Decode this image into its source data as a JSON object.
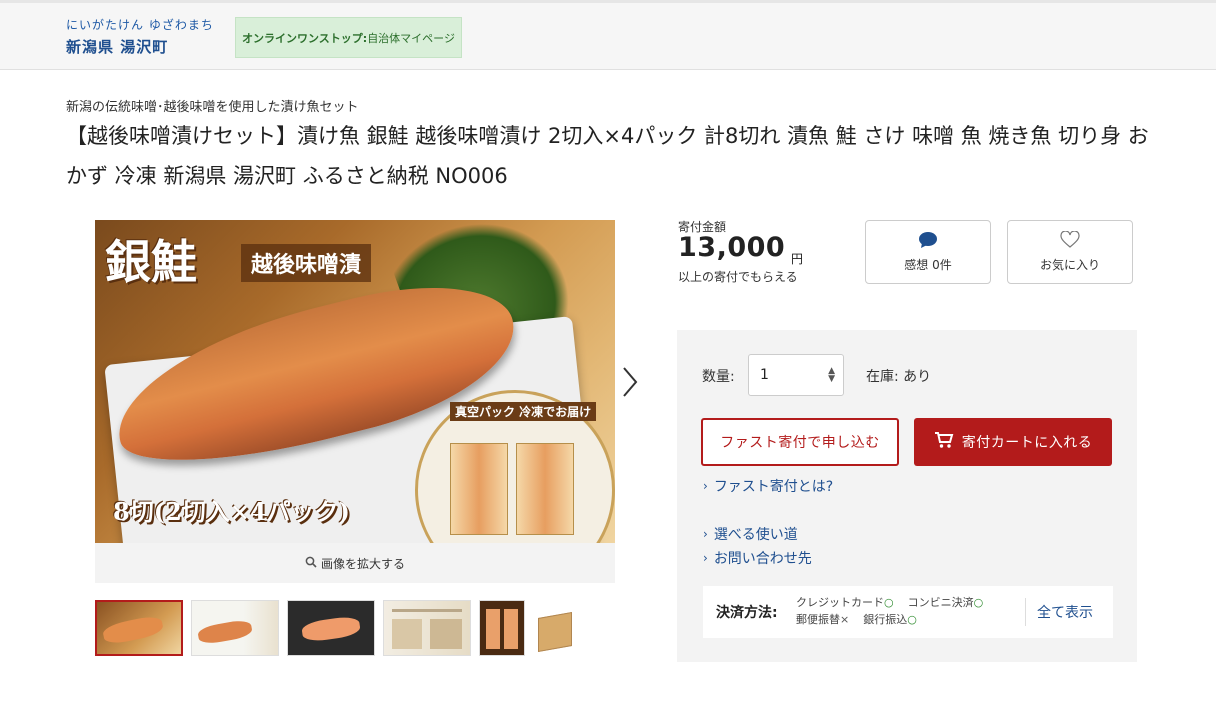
{
  "header": {
    "municipality_kana": "にいがたけん ゆざわまち",
    "municipality_name": "新潟県 湯沢町",
    "onestop_bold": "オンラインワンストップ:",
    "onestop_light": "自治体マイページ"
  },
  "product": {
    "subtitle": "新潟の伝統味噌･越後味噌を使用した漬け魚セット",
    "title": "【越後味噌漬けセット】漬け魚 銀鮭 越後味噌漬け 2切入×4パック 計8切れ 漬魚 鮭 さけ 味噌 魚 焼き魚 切り身 おかず 冷凍 新潟県 湯沢町 ふるさと納税 NO006",
    "image_text": {
      "brand": "銀鮭",
      "banner": "越後味噌漬",
      "pack_note": "真空パック 冷凍でお届け",
      "count": "8切(2切入×4パック)"
    },
    "zoom_label": "画像を拡大する",
    "thumbnails": [
      {
        "label": "thumb-1"
      },
      {
        "label": "thumb-2"
      },
      {
        "label": "thumb-3"
      },
      {
        "label": "thumb-4"
      },
      {
        "label": "thumb-5"
      },
      {
        "label": "thumb-6"
      }
    ]
  },
  "donation": {
    "label": "寄付金額",
    "amount": "13,000",
    "unit": "円",
    "note": "以上の寄付でもらえる"
  },
  "actions": {
    "reviews_label": "感想 0件",
    "favorite_label": "お気に入り"
  },
  "order": {
    "qty_label": "数量:",
    "qty_value": "1",
    "stock": "在庫: あり",
    "fast_button": "ファスト寄付で申し込む",
    "cart_button": "寄付カートに入れる",
    "links": [
      "ファスト寄付とは?",
      "選べる使い道",
      "お問い合わせ先"
    ]
  },
  "payment": {
    "label": "決済方法:",
    "methods": [
      {
        "name": "クレジットカード",
        "mark": "○"
      },
      {
        "name": "コンビニ決済",
        "mark": "○"
      },
      {
        "name": "郵便振替",
        "mark": "×"
      },
      {
        "name": "銀行振込",
        "mark": "○"
      }
    ],
    "show_all": "全て表示"
  },
  "colors": {
    "accent_red": "#b31b1b",
    "link_blue": "#1f4f8f",
    "onestop_bg": "#d9efd9"
  }
}
